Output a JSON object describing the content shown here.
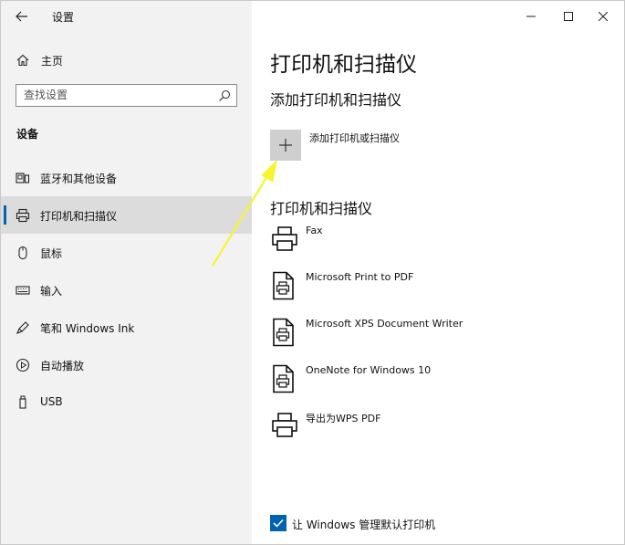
{
  "window": {
    "title": "设置",
    "back_icon": "back-arrow-icon",
    "controls": [
      "minimize-icon",
      "maximize-icon",
      "close-icon"
    ]
  },
  "sidebar": {
    "home_label": "主页",
    "search": {
      "placeholder": "查找设置",
      "value": ""
    },
    "section_title": "设备",
    "items": [
      {
        "label": "蓝牙和其他设备",
        "icon": "bluetooth-device-icon",
        "active": false
      },
      {
        "label": "打印机和扫描仪",
        "icon": "printer-icon",
        "active": true
      },
      {
        "label": "鼠标",
        "icon": "mouse-icon",
        "active": false
      },
      {
        "label": "输入",
        "icon": "keyboard-icon",
        "active": false
      },
      {
        "label": "笔和 Windows Ink",
        "icon": "pen-icon",
        "active": false
      },
      {
        "label": "自动播放",
        "icon": "autoplay-icon",
        "active": false
      },
      {
        "label": "USB",
        "icon": "usb-icon",
        "active": false
      }
    ]
  },
  "main": {
    "title": "打印机和扫描仪",
    "add_section_title": "添加打印机和扫描仪",
    "add_button_label": "添加打印机或扫描仪",
    "list_title": "打印机和扫描仪",
    "printers": [
      {
        "name": "Fax",
        "icon": "fax-printer-icon"
      },
      {
        "name": "Microsoft Print to PDF",
        "icon": "document-printer-icon"
      },
      {
        "name": "Microsoft XPS Document Writer",
        "icon": "document-printer-icon"
      },
      {
        "name": "OneNote for Windows 10",
        "icon": "document-printer-icon"
      },
      {
        "name": "导出为WPS PDF",
        "icon": "printer-icon"
      }
    ],
    "default_printer_checkbox": {
      "label": "让 Windows 管理默认打印机",
      "checked": true
    }
  },
  "colors": {
    "accent": "#0063b1",
    "sidebar_bg": "#f2f2f2",
    "active_bg": "#dcdcdc",
    "annotation_arrow": "#f5f531"
  }
}
